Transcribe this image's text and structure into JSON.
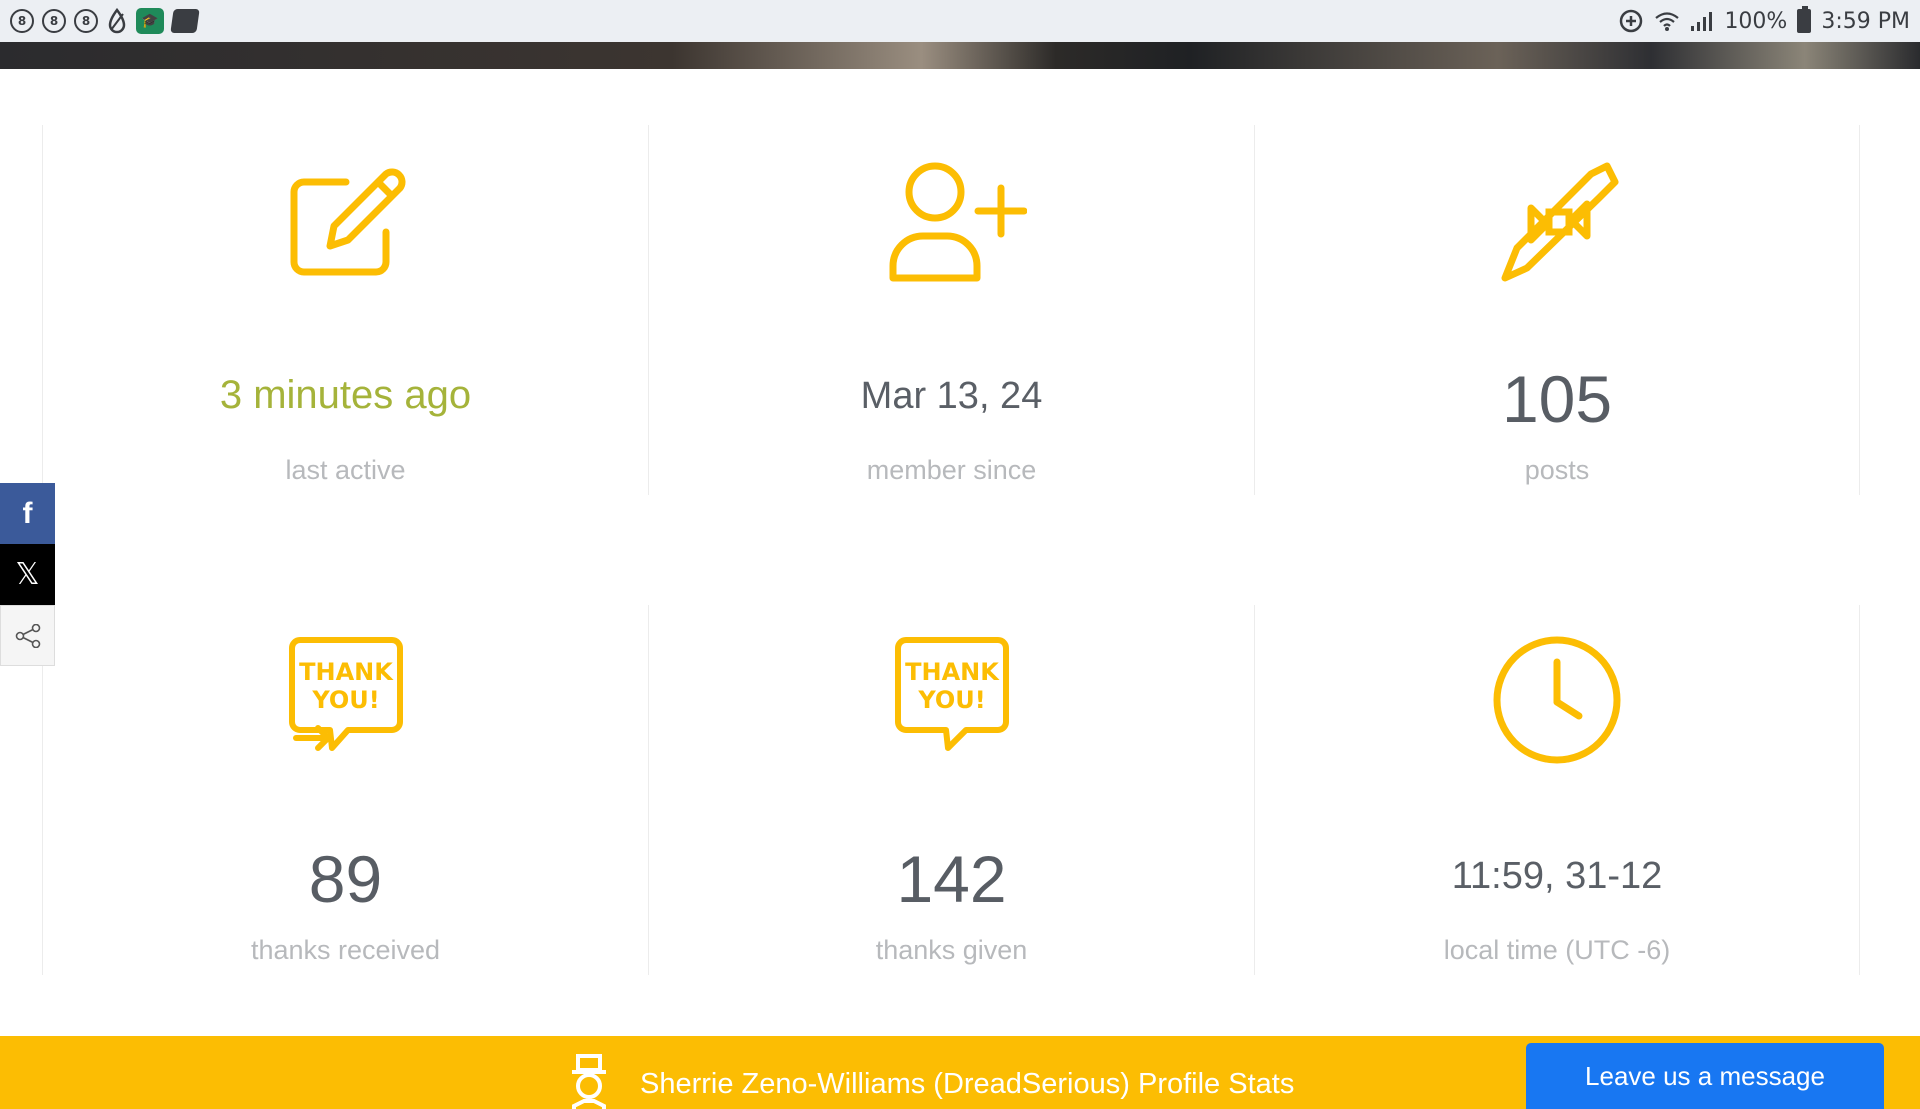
{
  "status_bar": {
    "left_icons": [
      "notification-badge-icon",
      "notification-badge-icon",
      "notification-badge-icon",
      "water-drop-icon",
      "graduation-app-icon",
      "layered-app-icon"
    ],
    "badge_text": "8",
    "battery_percent": "100%",
    "time": "3:59 PM"
  },
  "stats": [
    {
      "icon": "edit-icon",
      "value": "3 minutes ago",
      "label": "last active"
    },
    {
      "icon": "add-user-icon",
      "value": "Mar 13, 24",
      "label": "member since"
    },
    {
      "icon": "rocket-bowtie-icon",
      "value": "105",
      "label": "posts"
    },
    {
      "icon": "thank-you-received-icon",
      "value": "89",
      "label": "thanks received"
    },
    {
      "icon": "thank-you-given-icon",
      "value": "142",
      "label": "thanks given"
    },
    {
      "icon": "clock-icon",
      "value": "11:59, 31-12",
      "label": "local time (UTC -6)"
    }
  ],
  "thank_you": {
    "line1": "THANK",
    "line2": "YOU!"
  },
  "social": {
    "facebook": "f",
    "x": "𝕏"
  },
  "footer": {
    "title": "Sherrie Zeno-Williams (DreadSerious) Profile Stats",
    "message_button": "Leave us a message"
  },
  "colors": {
    "accent": "#fcbd03",
    "green": "#a5b33a",
    "facebook": "#3b5a9a",
    "message_button": "#1877f2"
  }
}
